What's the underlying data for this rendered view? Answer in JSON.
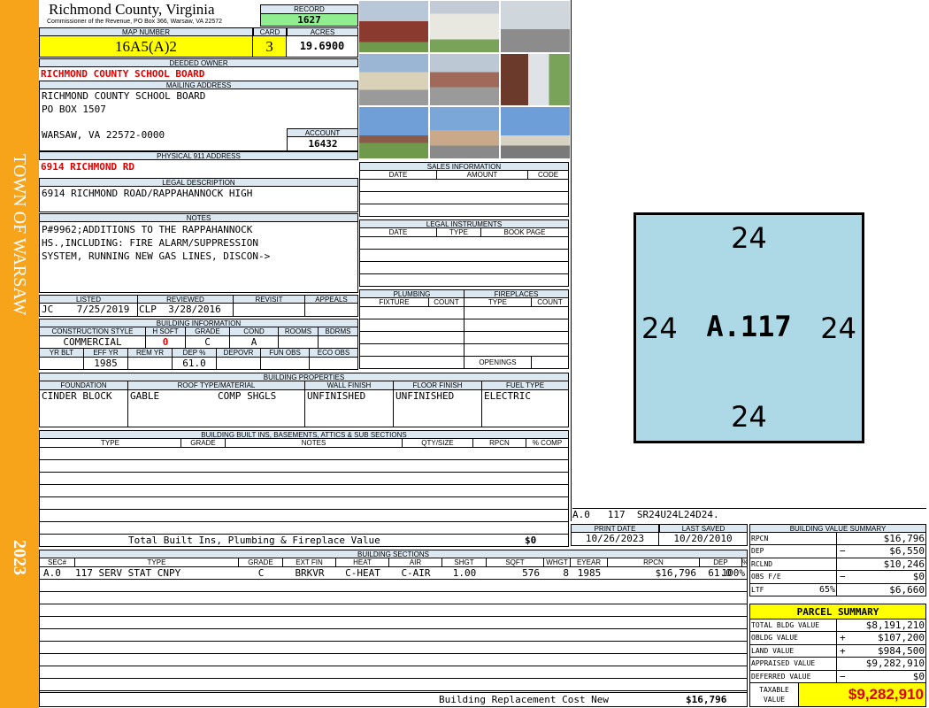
{
  "sidebar": {
    "town": "TOWN OF WARSAW",
    "year": "2023"
  },
  "header": {
    "county": "Richmond County, Virginia",
    "commissioner": "Commissioner of the Revenue, PO Box 366, Warsaw, VA 22572",
    "record_label": "RECORD",
    "record": "1627",
    "map_number_label": "MAP NUMBER",
    "map_number": "16A5(A)2",
    "card_label": "CARD",
    "card": "3",
    "acres_label": "ACRES",
    "acres": "19.6900"
  },
  "owner": {
    "deeded_owner_label": "DEEDED OWNER",
    "deeded_owner": "RICHMOND COUNTY SCHOOL BOARD",
    "mailing_label": "MAILING ADDRESS",
    "mailing_lines": [
      "RICHMOND COUNTY SCHOOL BOARD",
      "PO BOX 1507",
      "",
      "WARSAW, VA 22572-0000"
    ],
    "account_label": "ACCOUNT",
    "account": "16432",
    "address911_label": "PHYSICAL 911 ADDRESS",
    "address911": "6914 RICHMOND RD"
  },
  "legal": {
    "label": "LEGAL DESCRIPTION",
    "text": "6914 RICHMOND ROAD/RAPPAHANNOCK HIGH"
  },
  "notes": {
    "label": "NOTES",
    "lines": [
      "P#9962;ADDITIONS TO THE RAPPAHANNOCK",
      "HS.,INCLUDING: FIRE ALARM/SUPPRESSION",
      "SYSTEM, RUNNING NEW GAS LINES, DISCON->"
    ]
  },
  "status": {
    "listed_label": "LISTED",
    "listed_by": "JC",
    "listed_date": "7/25/2019",
    "reviewed_label": "REVIEWED",
    "reviewed_by": "CLP",
    "reviewed_date": "3/28/2016",
    "revisit_label": "REVISIT",
    "appeals_label": "APPEALS"
  },
  "building_info": {
    "label": "BUILDING INFORMATION",
    "headers1": [
      "CONSTRUCTION STYLE",
      "H SOFT",
      "GRADE",
      "COND",
      "ROOMS",
      "BDRMS"
    ],
    "values1": [
      "COMMERCIAL",
      "0",
      "C",
      "A",
      "",
      ""
    ],
    "headers2": [
      "YR BLT",
      "EFF YR",
      "REM YR",
      "DEP %",
      "DEPOVR",
      "FUN OBS",
      "ECO OBS"
    ],
    "values2": [
      "",
      "1985",
      "",
      "61.0",
      "",
      "",
      ""
    ]
  },
  "sales": {
    "label": "SALES INFORMATION",
    "headers": [
      "DATE",
      "AMOUNT",
      "CODE"
    ]
  },
  "instruments": {
    "label": "LEGAL INSTRUMENTS",
    "headers": [
      "DATE",
      "TYPE",
      "BOOK PAGE"
    ]
  },
  "plumbing": {
    "label": "PLUMBING",
    "headers": [
      "FIXTURE",
      "COUNT"
    ]
  },
  "fireplaces": {
    "label": "FIREPLACES",
    "headers": [
      "TYPE",
      "COUNT"
    ],
    "openings_label": "OPENINGS"
  },
  "properties": {
    "label": "BUILDING PROPERTIES",
    "headers": [
      "FOUNDATION",
      "ROOF TYPE/MATERIAL",
      "WALL FINISH",
      "FLOOR FINISH",
      "FUEL TYPE"
    ],
    "foundation": "CINDER BLOCK",
    "roof_type": "GABLE",
    "roof_material": "COMP SHGLS",
    "wall": "UNFINISHED",
    "floor": "UNFINISHED",
    "fuel": "ELECTRIC"
  },
  "builtins": {
    "label": "BUILDING BUILT INS, BASEMENTS, ATTICS & SUB SECTIONS",
    "headers": [
      "TYPE",
      "GRADE",
      "NOTES",
      "QTY/SIZE",
      "RPCN",
      "% COMP"
    ],
    "total_label": "Total Built Ins, Plumbing & Fireplace Value",
    "total_value": "$0"
  },
  "sketch": {
    "top": "24",
    "left": "24",
    "center": "A.117",
    "right": "24",
    "bottom": "24",
    "caption": "A.0   117  SR24U24L24D24."
  },
  "dates": {
    "print_label": "PRINT DATE",
    "print": "10/26/2023",
    "saved_label": "LAST SAVED",
    "saved": "10/20/2010"
  },
  "sections": {
    "label": "BUILDING SECTIONS",
    "headers": [
      "SEC#",
      "TYPE",
      "GRADE",
      "EXT FIN",
      "HEAT",
      "AIR",
      "SHGT",
      "SQFT",
      "WHGT",
      "EYEAR",
      "RPCN",
      "DEP",
      "% COMP"
    ],
    "rows": [
      [
        "A.0",
        "117 SERV STAT CNPY",
        "C",
        "BRKVR",
        "C-HEAT",
        "C-AIR",
        "1.00",
        "576",
        "8",
        "1985",
        "$16,796",
        "61.0",
        "100%"
      ]
    ],
    "replacement_label": "Building Replacement Cost New",
    "replacement_value": "$16,796"
  },
  "value_summary": {
    "label": "BUILDING VALUE SUMMARY",
    "rows": [
      {
        "k": "RPCN",
        "sign": "",
        "extra": "",
        "v": "$16,796"
      },
      {
        "k": "DEP",
        "sign": "−",
        "extra": "",
        "v": "$6,550"
      },
      {
        "k": "RCLND",
        "sign": "",
        "extra": "",
        "v": "$10,246"
      },
      {
        "k": "OBS F/E",
        "sign": "−",
        "extra": "",
        "v": "$0"
      },
      {
        "k": "LTF",
        "sign": "",
        "extra": "65%",
        "v": "$6,660"
      }
    ]
  },
  "parcel": {
    "label": "PARCEL SUMMARY",
    "rows": [
      {
        "k": "TOTAL BLDG VALUE",
        "sign": "",
        "v": "$8,191,210"
      },
      {
        "k": "OBLDG VALUE",
        "sign": "+",
        "v": "$107,200"
      },
      {
        "k": "LAND VALUE",
        "sign": "+",
        "v": "$984,500"
      },
      {
        "k": "APPRAISED VALUE",
        "sign": "",
        "v": "$9,282,910"
      },
      {
        "k": "DEFERRED VALUE",
        "sign": "−",
        "v": "$0"
      }
    ],
    "taxable_label_1": "TAXABLE",
    "taxable_label_2": "VALUE",
    "taxable_value": "$9,282,910"
  },
  "colors": {
    "sidebar": "#f7a41a",
    "label_bg": "#dbe8f2",
    "yellow": "#ffff00",
    "green": "#90ee90",
    "sketch_fill": "#add8e6",
    "red": "#e00000"
  }
}
